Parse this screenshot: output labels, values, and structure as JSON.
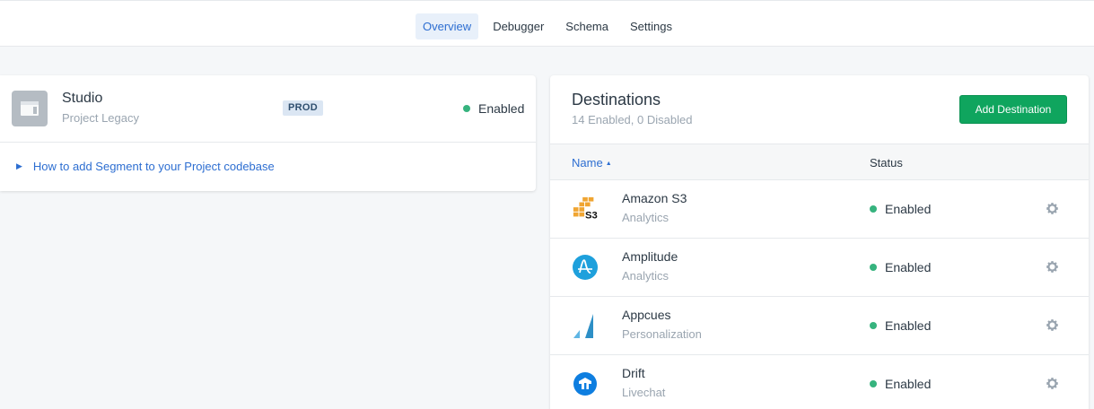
{
  "nav": {
    "tabs": [
      {
        "label": "Overview",
        "active": true
      },
      {
        "label": "Debugger"
      },
      {
        "label": "Schema"
      },
      {
        "label": "Settings"
      }
    ]
  },
  "source": {
    "name": "Studio",
    "subtitle": "Project Legacy",
    "badge": "PROD",
    "status": "Enabled",
    "howto_link": "How to add Segment to your Project codebase"
  },
  "destinations": {
    "title": "Destinations",
    "summary": "14 Enabled, 0 Disabled",
    "add_button": "Add Destination",
    "columns": {
      "name": "Name",
      "status": "Status"
    },
    "rows": [
      {
        "name": "Amazon S3",
        "category": "Analytics",
        "status": "Enabled",
        "icon": "amazon-s3-logo"
      },
      {
        "name": "Amplitude",
        "category": "Analytics",
        "status": "Enabled",
        "icon": "amplitude-logo"
      },
      {
        "name": "Appcues",
        "category": "Personalization",
        "status": "Enabled",
        "icon": "appcues-logo"
      },
      {
        "name": "Drift",
        "category": "Livechat",
        "status": "Enabled",
        "icon": "drift-logo"
      }
    ]
  },
  "colors": {
    "accent": "#2d6ed1",
    "enabled_dot": "#36b37e",
    "primary_button": "#0fa55e"
  }
}
